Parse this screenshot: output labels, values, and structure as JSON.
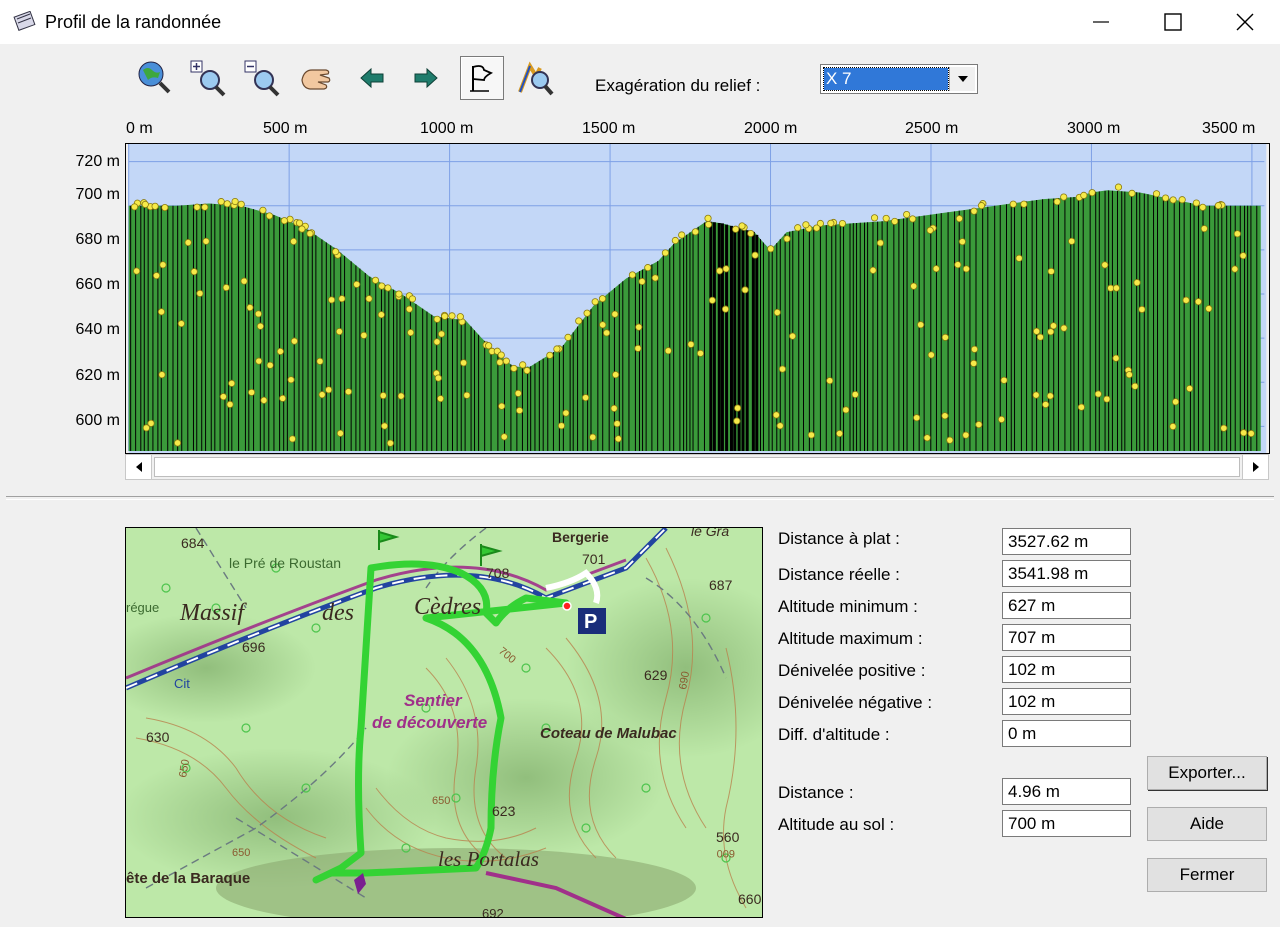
{
  "window": {
    "title": "Profil de la randonnée"
  },
  "toolbar": {
    "icons": [
      "globe-zoom-icon",
      "zoom-in-icon",
      "zoom-out-icon",
      "pan-hand-icon",
      "arrow-left-icon",
      "arrow-right-icon",
      "flag-icon",
      "profile-zoom-icon"
    ],
    "relief_label": "Exagération du relief :",
    "relief_value": "X 7"
  },
  "profile": {
    "x_ticks": [
      "0 m",
      "500 m",
      "1000 m",
      "1500 m",
      "2000 m",
      "2500 m",
      "3000 m",
      "3500 m"
    ],
    "y_ticks": [
      "720 m",
      "700 m",
      "680 m",
      "660 m",
      "640 m",
      "620 m",
      "600 m"
    ]
  },
  "chart_data": {
    "type": "area",
    "x_unit": "m",
    "y_unit": "m",
    "xlim": [
      0,
      3527.62
    ],
    "ylim": [
      587,
      728
    ],
    "x": [
      0,
      150,
      250,
      350,
      450,
      550,
      650,
      750,
      850,
      950,
      1050,
      1100,
      1150,
      1200,
      1250,
      1350,
      1450,
      1550,
      1650,
      1700,
      1750,
      1800,
      1850,
      1900,
      1950,
      1980,
      2000,
      2050,
      2150,
      2250,
      2350,
      2450,
      2550,
      2650,
      2750,
      2850,
      2950,
      3000,
      3050,
      3150,
      3250,
      3350,
      3450,
      3527.62
    ],
    "y": [
      700,
      700,
      701,
      700,
      696,
      690,
      680,
      668,
      660,
      650,
      648,
      640,
      633,
      627,
      627,
      636,
      655,
      667,
      675,
      683,
      688,
      693,
      692,
      690,
      688,
      683,
      680,
      688,
      691,
      692,
      693,
      695,
      697,
      699,
      701,
      703,
      704,
      706,
      707,
      706,
      703,
      700,
      700,
      700
    ],
    "line_color": "#000000",
    "fill_colors": [
      "#3a9a3a",
      "#000000"
    ],
    "sky_color": "#c3d7f7",
    "grid": true,
    "markers": "yellow points"
  },
  "map_labels": {
    "massif": "Massif",
    "des": "des",
    "cedres": "Cèdres",
    "pre_roustan": "le Pré de Roustan",
    "bergerie": "Bergerie",
    "sentier": "Sentier",
    "decouverte": "de découverte",
    "coteau": "Coteau de Malubac",
    "portalas": "les Portalas",
    "baraque": "ête de la Baraque",
    "regue": "régue",
    "cit": "Cit",
    "le_gra": "le Gra",
    "n684": "684",
    "n696": "696",
    "n701": "701",
    "n708": "708",
    "n687": "687",
    "n629": "629",
    "n650a": "650",
    "n630": "630",
    "n623": "623",
    "n560": "560",
    "n650b": "650",
    "n660": "660",
    "n692": "692",
    "n700": "700",
    "n690": "690",
    "n650c": "650",
    "n600": "600"
  },
  "stats": [
    {
      "label": "Distance à plat :",
      "value": "3527.62 m"
    },
    {
      "label": "Distance réelle :",
      "value": "3541.98 m"
    },
    {
      "label": "Altitude minimum :",
      "value": "627 m"
    },
    {
      "label": "Altitude maximum :",
      "value": "707 m"
    },
    {
      "label": "Dénivelée positive :",
      "value": "102 m"
    },
    {
      "label": "Dénivelée négative :",
      "value": "102 m"
    },
    {
      "label": "Diff. d'altitude :",
      "value": "0 m"
    }
  ],
  "cursor": {
    "distance_label": "Distance :",
    "distance_value": "4.96 m",
    "ground_label": "Altitude au sol :",
    "ground_value": "700 m"
  },
  "buttons": {
    "export": "Exporter...",
    "help": "Aide",
    "close": "Fermer"
  },
  "colors": {
    "accent": "#3078d8",
    "route": "#34d334",
    "map_bg": "#bde8a8"
  }
}
